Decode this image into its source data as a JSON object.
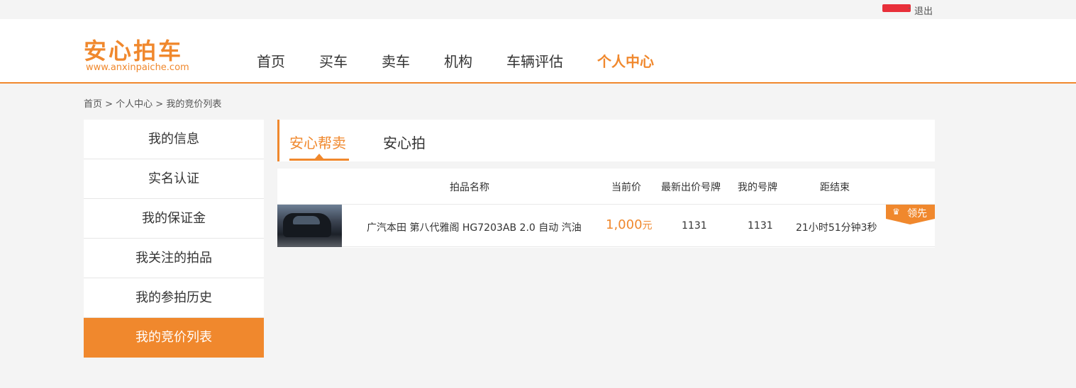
{
  "topbar": {
    "separator": "-",
    "logout": "退出"
  },
  "logo": {
    "name": "安心拍车",
    "url": "www.anxinpaiche.com"
  },
  "nav": {
    "home": "首页",
    "buy": "买车",
    "sell": "卖车",
    "agency": "机构",
    "evaluate": "车辆评估",
    "personal": "个人中心"
  },
  "breadcrumb": "首页 > 个人中心 > 我的竞价列表",
  "sidebar": {
    "items": [
      {
        "label": "我的信息"
      },
      {
        "label": "实名认证"
      },
      {
        "label": "我的保证金"
      },
      {
        "label": "我关注的拍品"
      },
      {
        "label": "我的参拍历史"
      },
      {
        "label": "我的竞价列表"
      }
    ]
  },
  "tabs": {
    "help_sell": "安心帮卖",
    "anxin_pai": "安心拍"
  },
  "table": {
    "headers": {
      "name": "拍品名称",
      "price": "当前价",
      "latest_plate": "最新出价号牌",
      "my_plate": "我的号牌",
      "countdown": "距结束"
    },
    "rows": [
      {
        "name": "广汽本田 第八代雅阁 HG7203AB 2.0 自动 汽油",
        "price": "1,000",
        "unit": "元",
        "latest_plate": "1131",
        "my_plate": "1131",
        "countdown": "21小时51分钟3秒",
        "badge": "领先"
      }
    ]
  },
  "colors": {
    "accent": "#f0882d",
    "redacted": "#e8303a"
  },
  "icons": {
    "badge": "crown-icon"
  }
}
